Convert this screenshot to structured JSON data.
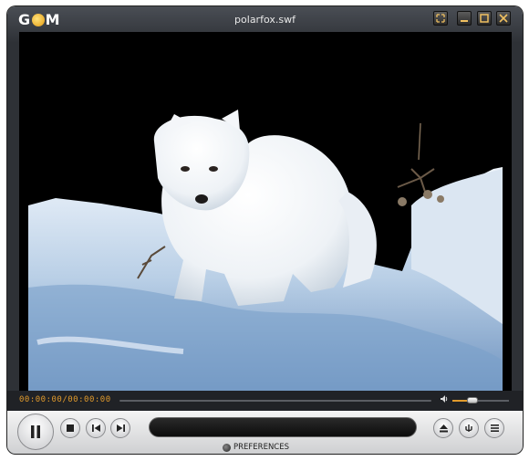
{
  "app": {
    "logo_text": "GOM",
    "title": "polarfox.swf"
  },
  "window_buttons": [
    "fullscreen-icon",
    "minimize-icon",
    "maximize-icon",
    "close-icon"
  ],
  "playback": {
    "time_display": "00:00:00/00:00:00",
    "progress": 0.0,
    "volume": 0.25
  },
  "controls": {
    "preferences_label": "PREFERENCES"
  },
  "icons": {
    "play_pause": "pause-icon",
    "stop": "stop-icon",
    "prev": "previous-icon",
    "next": "next-icon",
    "eject": "eject-icon",
    "equalizer": "equalizer-icon",
    "menu": "menu-icon",
    "volume": "speaker-icon"
  },
  "colors": {
    "accent": "#e09a2c",
    "frame": "#2e3136"
  }
}
